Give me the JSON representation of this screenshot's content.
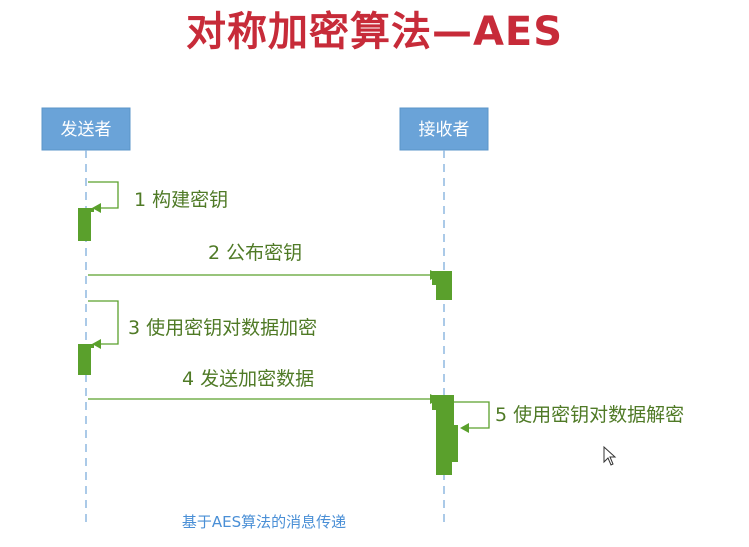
{
  "title": "对称加密算法—AES",
  "actors": {
    "sender": "发送者",
    "receiver": "接收者"
  },
  "steps": {
    "step1": "1 构建密钥",
    "step2": "2 公布密钥",
    "step3": "3 使用密钥对数据加密",
    "step4": "4 发送加密数据",
    "step5": "5 使用密钥对数据解密"
  },
  "caption": "基于AES算法的消息传递",
  "colors": {
    "title": "#c72b39",
    "actor_box": "#6aa3d8",
    "lifeline": "#8fb8e0",
    "message": "#4f7a26",
    "activation": "#5aa02c",
    "caption": "#4a8fd6"
  }
}
